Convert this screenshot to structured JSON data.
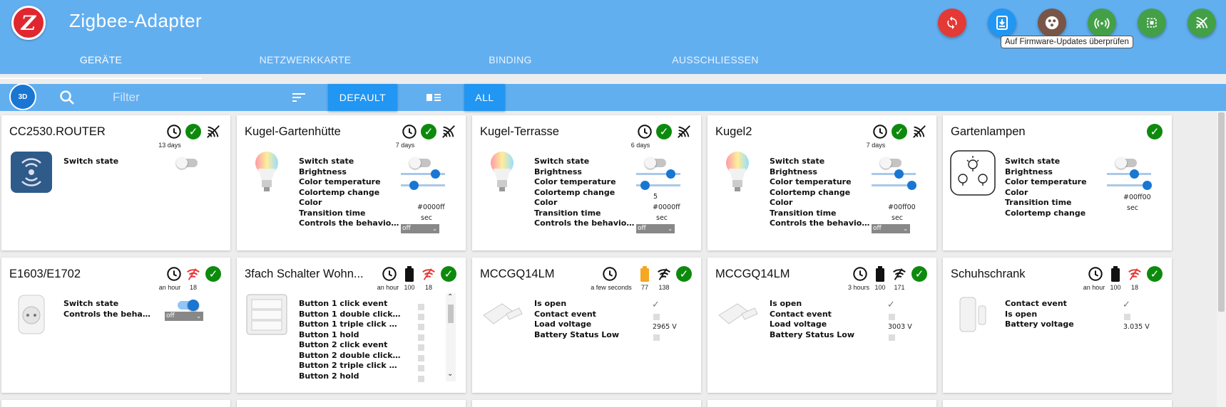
{
  "header": {
    "title": "Zigbee-Adapter",
    "logo_letter": "Z",
    "tooltip": "Auf Firmware-Updates überprüfen",
    "buttons": [
      {
        "name": "refresh-button",
        "icon": "refresh-icon",
        "color": "#e53935"
      },
      {
        "name": "firmware-update-button",
        "icon": "download-icon",
        "color": "#2196f3"
      },
      {
        "name": "groups-button",
        "icon": "groups-icon",
        "color": "#795548"
      },
      {
        "name": "signal-button",
        "icon": "signal-icon",
        "color": "#43a047"
      },
      {
        "name": "chip-button",
        "icon": "chip-icon",
        "color": "#43a047"
      },
      {
        "name": "pairing-button",
        "icon": "wireless-icon",
        "color": "#43a047"
      }
    ]
  },
  "tabs": [
    "GERÄTE",
    "NETZWERKKARTE",
    "BINDING",
    "AUSSCHLIESSEN"
  ],
  "toolbar": {
    "btn3d": "3D",
    "filter_placeholder": "Filter",
    "default_label": "DEFAULT",
    "all_label": "ALL"
  },
  "colors": {
    "header": "#62aff0",
    "accent": "#2196f3",
    "ok": "#0d8a0d",
    "warn": "#e53935"
  },
  "cards": [
    {
      "title": "CC2530.ROUTER",
      "time": "13 days",
      "states": [
        "Switch state"
      ]
    },
    {
      "title": "Kugel-Gartenhütte",
      "time": "7 days",
      "states": [
        "Switch state",
        "Brightness",
        "Color temperature",
        "Colortemp change",
        "Color",
        "Transition time",
        "Controls the behavior w..."
      ],
      "color_value": "#0000ff",
      "sec": "sec",
      "select": "off"
    },
    {
      "title": "Kugel-Terrasse",
      "time": "6 days",
      "states": [
        "Switch state",
        "Brightness",
        "Color temperature",
        "Colortemp change",
        "Color",
        "Transition time",
        "Controls the behavior w..."
      ],
      "colortemp_change": "5",
      "color_value": "#0000ff",
      "sec": "sec",
      "select": "off"
    },
    {
      "title": "Kugel2",
      "time": "7 days",
      "states": [
        "Switch state",
        "Brightness",
        "Color temperature",
        "Colortemp change",
        "Color",
        "Transition time",
        "Controls the behavior w..."
      ],
      "color_value": "#00ff00",
      "sec": "sec",
      "select": "off"
    },
    {
      "title": "Gartenlampen",
      "states": [
        "Switch state",
        "Brightness",
        "Color temperature",
        "Color",
        "Transition time",
        "Colortemp change"
      ],
      "color_value": "#00ff00",
      "sec": "sec"
    },
    {
      "title": "E1603/E1702",
      "time": "an hour",
      "link": "18",
      "states": [
        "Switch state",
        "Controls the behaviour ..."
      ],
      "select": "off"
    },
    {
      "title": "3fach Schalter Wohn...",
      "time": "an hour",
      "battery": "100",
      "link": "18",
      "states": [
        "Button 1 click event",
        "Button 1 double click ev...",
        "Button 1 triple click event",
        "Button 1 hold",
        "Button 2 click event",
        "Button 2 double click ev...",
        "Button 2 triple click event",
        "Button 2 hold"
      ]
    },
    {
      "title": "MCCGQ14LM",
      "time": "a few seconds",
      "battery": "77",
      "link": "138",
      "states": [
        "Is open",
        "Contact event",
        "Load voltage",
        "Battery Status Low"
      ],
      "voltage": "2965 V"
    },
    {
      "title": "MCCGQ14LM",
      "time": "3 hours",
      "battery": "100",
      "link": "171",
      "states": [
        "Is open",
        "Contact event",
        "Load voltage",
        "Battery Status Low"
      ],
      "voltage": "3003 V"
    },
    {
      "title": "Schuhschrank",
      "time": "an hour",
      "battery": "100",
      "link": "18",
      "states": [
        "Contact event",
        "Is open",
        "Battery voltage"
      ],
      "voltage": "3.035 V"
    }
  ]
}
